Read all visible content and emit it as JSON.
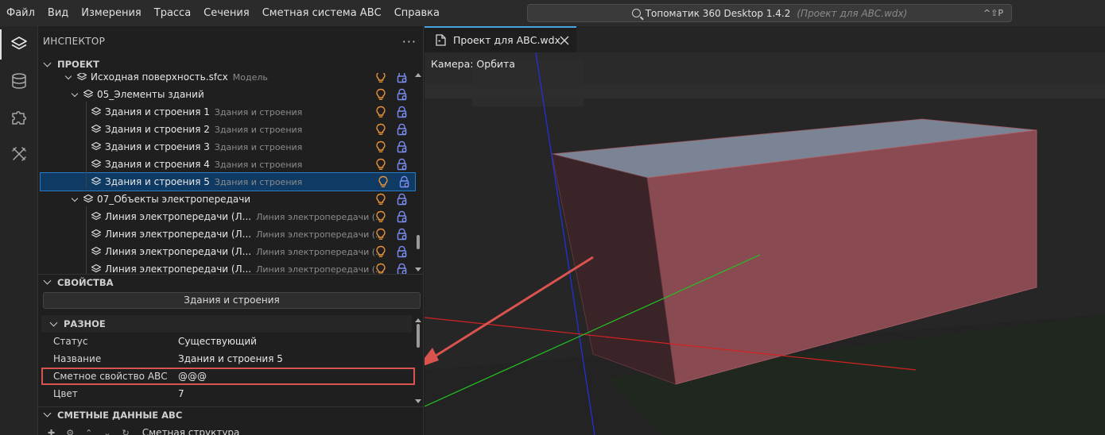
{
  "menubar": {
    "items": [
      "Файл",
      "Вид",
      "Измерения",
      "Трасса",
      "Сечения",
      "Сметная система АВС",
      "Справка"
    ]
  },
  "command_center": {
    "title": "Топоматик 360 Desktop 1.4.2",
    "project": "(Проект для АВС.wdx)",
    "shortcut": "^⇧P"
  },
  "activity_bar": {
    "icons": [
      "layers-icon",
      "database-icon",
      "puzzle-icon",
      "tools-icon"
    ]
  },
  "inspector": {
    "title": "ИНСПЕКТОР",
    "project_section": "ПРОЕКТ",
    "tree": [
      {
        "name": "Исходная поверхность.sfcx",
        "type": "Модель",
        "level": 0,
        "expandable": true,
        "cut": true
      },
      {
        "name": "05_Элементы зданий",
        "type": "",
        "level": 1,
        "expandable": true
      },
      {
        "name": "Здания и строения 1",
        "type": "Здания и строения",
        "level": 2
      },
      {
        "name": "Здания и строения 2",
        "type": "Здания и строения",
        "level": 2
      },
      {
        "name": "Здания и строения 3",
        "type": "Здания и строения",
        "level": 2
      },
      {
        "name": "Здания и строения 4",
        "type": "Здания и строения",
        "level": 2
      },
      {
        "name": "Здания и строения 5",
        "type": "Здания и строения",
        "level": 2,
        "selected": true
      },
      {
        "name": "07_Объекты электропередачи",
        "type": "",
        "level": 1,
        "expandable": true
      },
      {
        "name": "Линия электропередачи (Л...",
        "type": "Линия электропередачи (...",
        "level": 2
      },
      {
        "name": "Линия электропередачи (Л...",
        "type": "Линия электропередачи (...",
        "level": 2
      },
      {
        "name": "Линия электропередачи (Л...",
        "type": "Линия электропередачи (...",
        "level": 2
      },
      {
        "name": "Линия электропередачи (Л...",
        "type": "Линия электропередачи (...",
        "level": 2
      }
    ]
  },
  "properties": {
    "section": "СВОЙСТВА",
    "object_type": "Здания и строения",
    "group": "РАЗНОЕ",
    "rows": [
      {
        "name": "Статус",
        "value": "Существующий"
      },
      {
        "name": "Название",
        "value": "Здания и строения 5"
      },
      {
        "name": "Сметное свойство АВС",
        "value": "@@@",
        "highlighted": true
      },
      {
        "name": "Цвет",
        "value": "7"
      }
    ]
  },
  "abc_data": {
    "section": "СМЕТНЫЕ ДАННЫЕ АВС",
    "toolbar_label": "Сметная структура"
  },
  "editor": {
    "tab_label": "Проект для АВС.wdx",
    "camera_label": "Камера: Орбита"
  },
  "colors": {
    "accent": "#4aa3df",
    "selection": "#0e3a64",
    "highlight": "#d9534f",
    "bulb": "#e8923a",
    "lock": "#7b8cf0",
    "building_side": "#8a4a52",
    "building_top": "#7a8494"
  }
}
